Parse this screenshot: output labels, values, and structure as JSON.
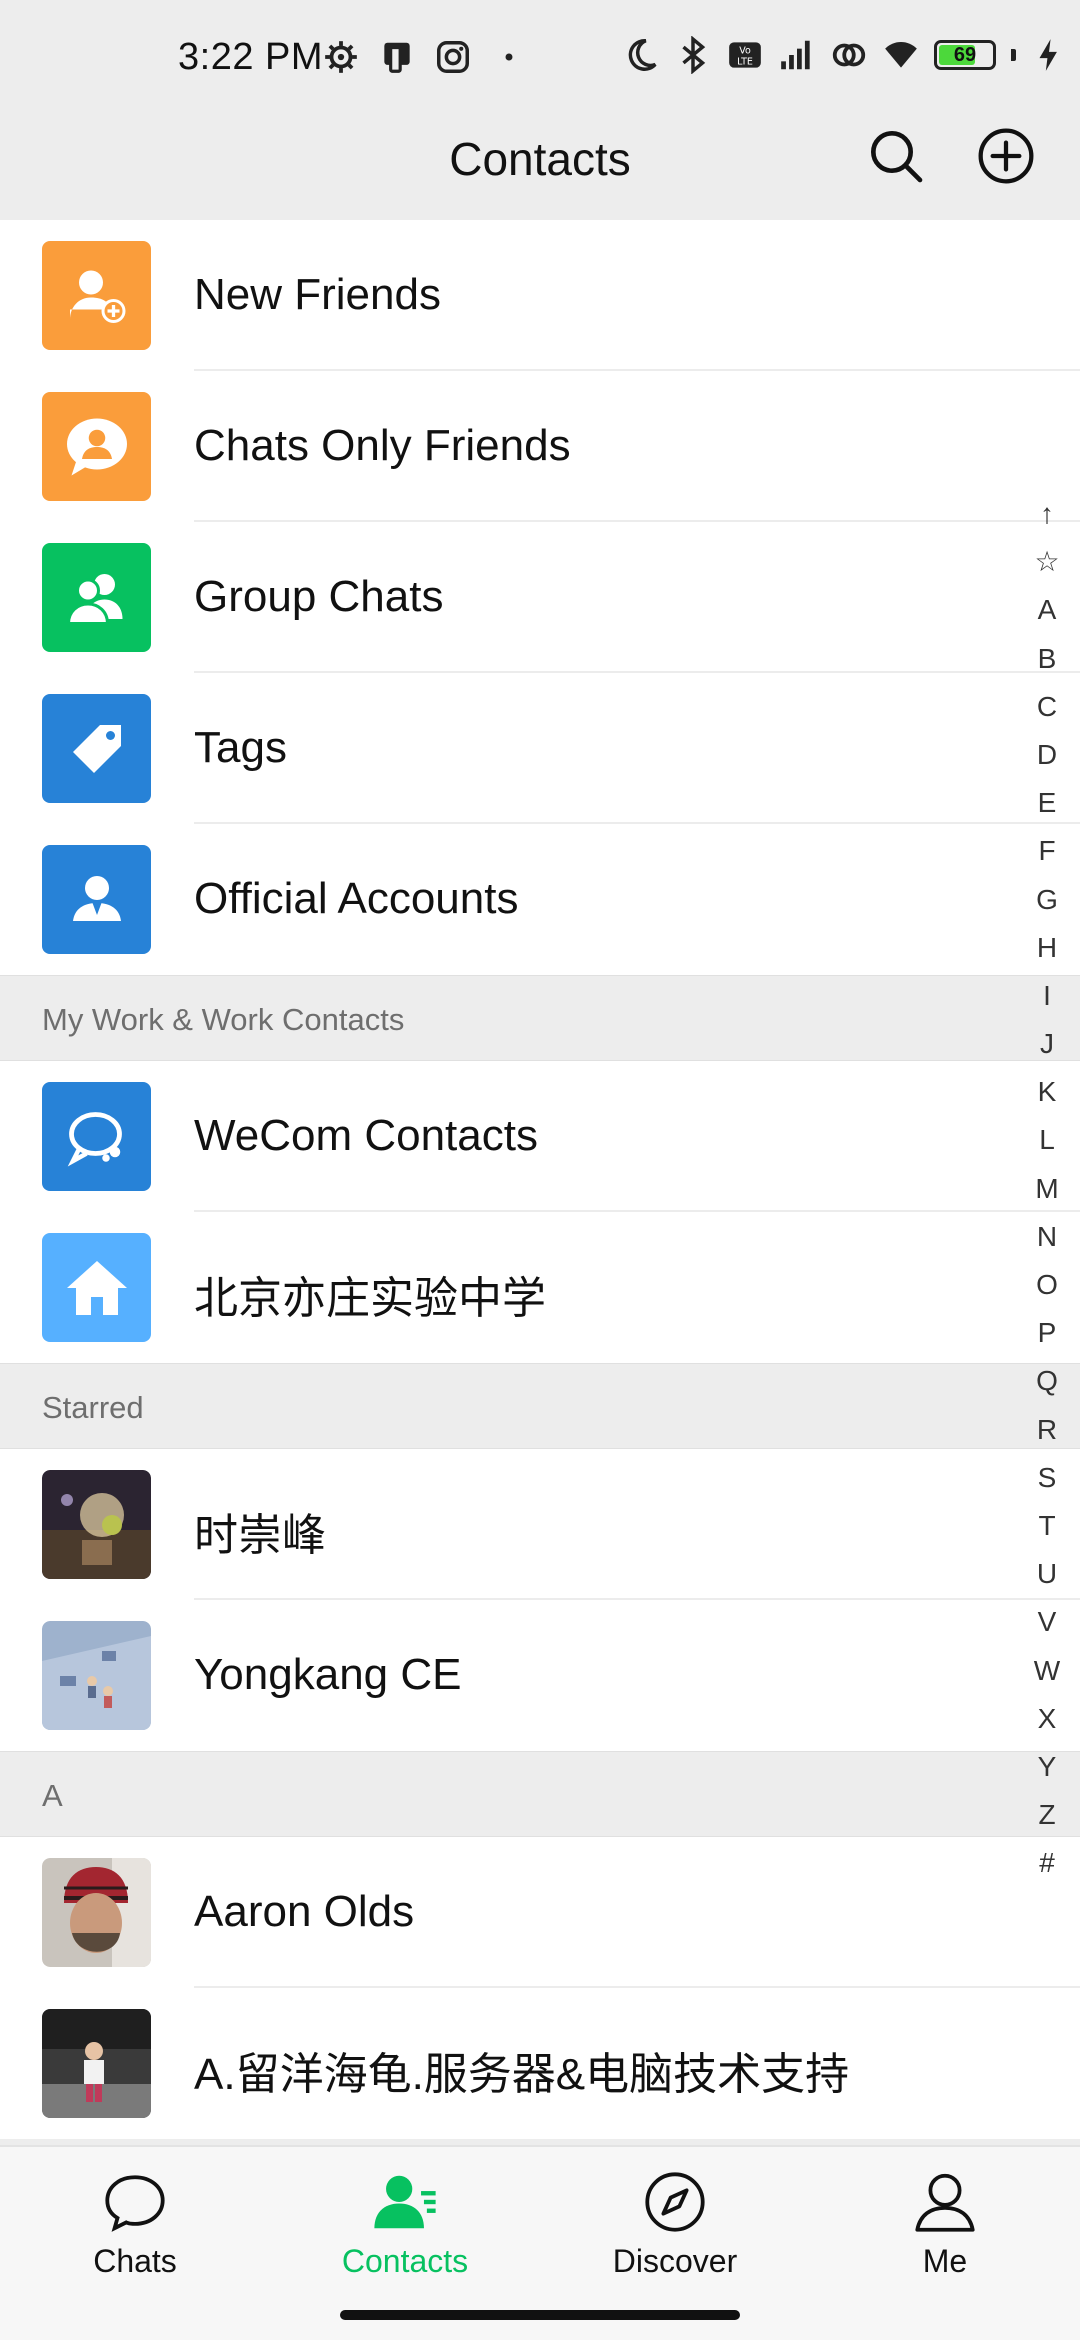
{
  "status_bar": {
    "time": "3:22 PM",
    "battery": "69",
    "icons": [
      "settings-gear-icon",
      "phone-card-icon",
      "instagram-icon",
      "dot-icon",
      "moon-icon",
      "bluetooth-icon",
      "volte-icon",
      "signal-icon",
      "hotspot-icon",
      "wifi-icon",
      "battery-icon",
      "charging-icon"
    ]
  },
  "header": {
    "title": "Contacts",
    "search_icon": "search-icon",
    "add_icon": "add-circle-icon"
  },
  "colors": {
    "orange": "#fa9d3b",
    "green": "#07c160",
    "blue": "#2782d7",
    "light_blue": "#56b0ff",
    "accent": "#07c160"
  },
  "quick_items": [
    {
      "label": "New Friends",
      "icon": "add-friend-icon"
    },
    {
      "label": "Chats Only Friends",
      "icon": "chat-bubble-person-icon"
    },
    {
      "label": "Group Chats",
      "icon": "group-icon"
    },
    {
      "label": "Tags",
      "icon": "tag-icon"
    },
    {
      "label": "Official Accounts",
      "icon": "official-account-icon"
    }
  ],
  "sections": {
    "work": {
      "title": "My Work & Work Contacts",
      "items": [
        {
          "label": "WeCom Contacts",
          "icon": "wecom-icon"
        },
        {
          "label": "北京亦庄实验中学",
          "icon": "home-icon"
        }
      ]
    },
    "starred": {
      "title": "Starred",
      "items": [
        {
          "label": "时崇峰",
          "icon": "avatar"
        },
        {
          "label": "Yongkang CE",
          "icon": "avatar"
        }
      ]
    },
    "a": {
      "title": "A",
      "items": [
        {
          "label": "Aaron Olds",
          "icon": "avatar"
        },
        {
          "label": "A.留洋海龟.服务器&电脑技术支持",
          "icon": "avatar"
        }
      ]
    }
  },
  "index_bar": [
    "↑",
    "☆",
    "A",
    "B",
    "C",
    "D",
    "E",
    "F",
    "G",
    "H",
    "I",
    "J",
    "K",
    "L",
    "M",
    "N",
    "O",
    "P",
    "Q",
    "R",
    "S",
    "T",
    "U",
    "V",
    "W",
    "X",
    "Y",
    "Z",
    "#"
  ],
  "tabbar": {
    "tabs": [
      {
        "label": "Chats",
        "icon": "chat-bubble-icon",
        "active": false
      },
      {
        "label": "Contacts",
        "icon": "contacts-icon",
        "active": true
      },
      {
        "label": "Discover",
        "icon": "compass-icon",
        "active": false
      },
      {
        "label": "Me",
        "icon": "person-icon",
        "active": false
      }
    ]
  }
}
